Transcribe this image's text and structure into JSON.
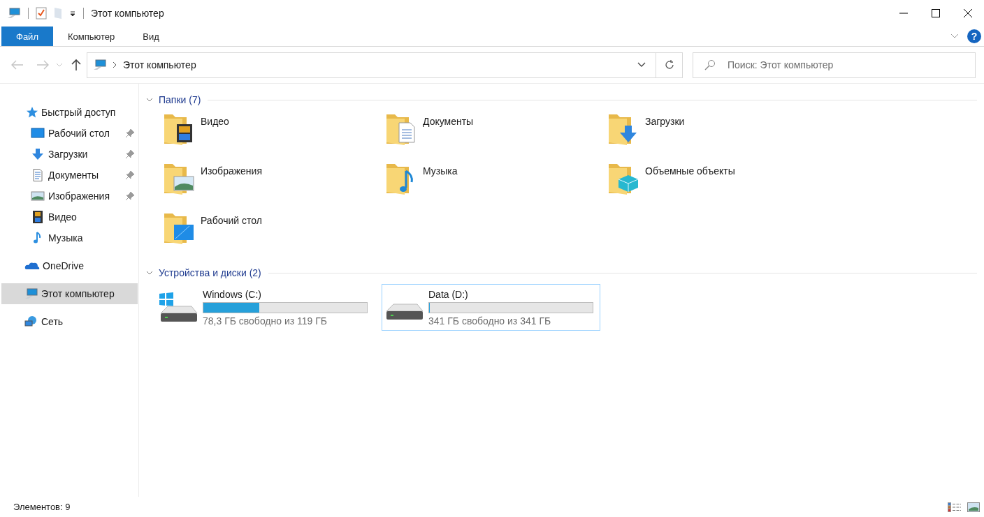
{
  "window": {
    "title": "Этот компьютер"
  },
  "ribbon": {
    "tabs": [
      {
        "label": "Файл",
        "selected": true
      },
      {
        "label": "Компьютер",
        "selected": false
      },
      {
        "label": "Вид",
        "selected": false
      }
    ],
    "help_label": "?"
  },
  "navigation": {
    "back": {
      "disabled": true
    },
    "forward": {
      "disabled": true
    },
    "up": {
      "disabled": false
    }
  },
  "address_bar": {
    "path": "Этот компьютер"
  },
  "search": {
    "placeholder": "Поиск: Этот компьютер"
  },
  "sidebar": {
    "items": [
      {
        "label": "Быстрый доступ",
        "selected": false,
        "children": [
          {
            "label": "Рабочий стол",
            "pinned": true,
            "selected": false
          },
          {
            "label": "Загрузки",
            "pinned": true,
            "selected": false
          },
          {
            "label": "Документы",
            "pinned": true,
            "selected": false
          },
          {
            "label": "Изображения",
            "pinned": true,
            "selected": false
          },
          {
            "label": "Видео",
            "pinned": false,
            "selected": false
          },
          {
            "label": "Музыка",
            "pinned": false,
            "selected": false
          }
        ]
      },
      {
        "label": "OneDrive",
        "selected": false
      },
      {
        "label": "Этот компьютер",
        "selected": true
      },
      {
        "label": "Сеть",
        "selected": false
      }
    ]
  },
  "folders": {
    "header": "Папки (7)",
    "expanded": true,
    "items": [
      {
        "name": "Видео"
      },
      {
        "name": "Документы"
      },
      {
        "name": "Загрузки"
      },
      {
        "name": "Изображения"
      },
      {
        "name": "Музыка"
      },
      {
        "name": "Объемные объекты"
      },
      {
        "name": "Рабочий стол"
      }
    ]
  },
  "drives": {
    "header": "Устройства и диски",
    "count": "(2)",
    "expanded": true,
    "items": [
      {
        "name": "Windows (C:)",
        "level": 0.34,
        "free_text": "78,3 ГБ свободно из 119 ГБ",
        "system": true,
        "highlighted": false
      },
      {
        "name": "Data (D:)",
        "level": 0.005,
        "free_text": "341 ГБ свободно из 341 ГБ",
        "system": false,
        "highlighted": true
      }
    ]
  },
  "status_bar": {
    "item_count": "Элементов: 9"
  }
}
